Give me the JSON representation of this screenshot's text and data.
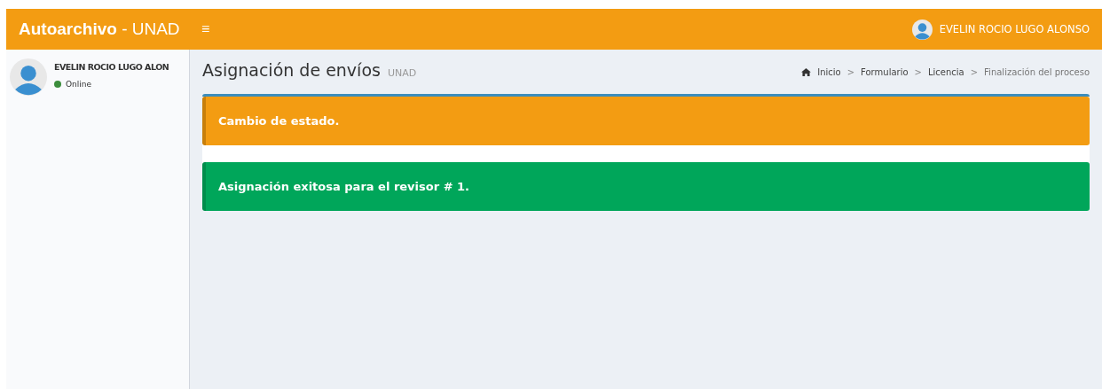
{
  "header": {
    "logo_bold": "Autoarchivo",
    "logo_rest": "- UNAD",
    "menu_toggle": "≡",
    "user_name": "EVELIN ROCIO LUGO ALONSO"
  },
  "sidebar": {
    "user_name": "EVELIN ROCIO LUGO ALON",
    "status": {
      "label": "Online",
      "color": "#3c8d3c"
    }
  },
  "page": {
    "title": "Asignación de envíos",
    "subtitle": "UNAD"
  },
  "breadcrumb": [
    {
      "label": "Inicio",
      "active": false
    },
    {
      "label": "Formulario",
      "active": false
    },
    {
      "label": "Licencia",
      "active": false
    },
    {
      "label": "Finalización del proceso",
      "active": true
    }
  ],
  "breadcrumb_separator": ">",
  "alerts": [
    {
      "kind": "warning",
      "text": "Cambio de estado."
    },
    {
      "kind": "success",
      "text": "Asignación exitosa para el revisor # 1."
    }
  ]
}
